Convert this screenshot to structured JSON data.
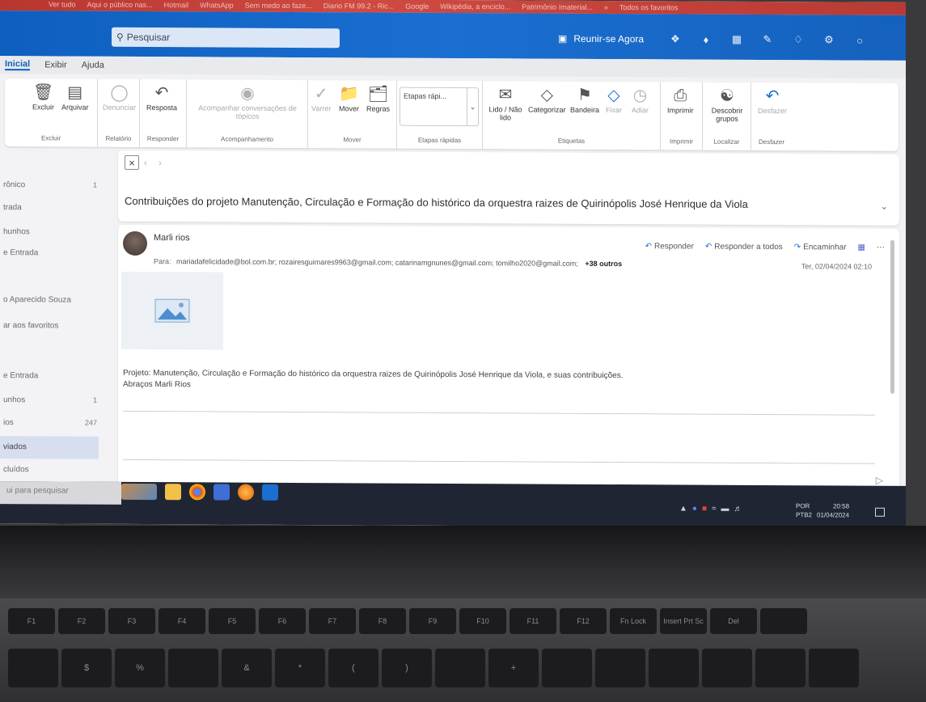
{
  "browser_bookmarks": [
    "",
    "Ver tudo",
    "Aqui o público nas...",
    "Hotmail",
    "WhatsApp",
    "Sem medo ao faze...",
    "Diario FM 99.2 - Ric...",
    "Google",
    "Wikipédia, a enciclo...",
    "Patrimônio Imaterial...",
    "»",
    "Todos os favoritos"
  ],
  "search": {
    "placeholder": "Pesquisar"
  },
  "topbar": {
    "meet_label": "Reunir-se Agora"
  },
  "menu_tabs": [
    "Inicial",
    "Exibir",
    "Ajuda"
  ],
  "ribbon": {
    "delete": "Excluir",
    "archive": "Arquivar",
    "group_delete": "Excluir",
    "report": "Denunciar",
    "group_report": "Relatório",
    "respond": "Resposta",
    "group_respond": "Responder",
    "follow": "Acompanhar conversações de tópicos",
    "group_follow": "Acompanhamento",
    "sweep": "Varrer",
    "move": "Mover",
    "rules": "Regras",
    "group_move": "Mover",
    "quick_steps": "Etapas rápi...",
    "group_quick": "Etapas rápidas",
    "read_unread": "Lido / Não lido",
    "categorize": "Categorizar",
    "flag": "Bandeira",
    "pin": "Fixar",
    "snooze": "Adiar",
    "group_tags": "Etiquetas",
    "print": "Imprimir",
    "group_print": "Imprimir",
    "discover_groups": "Descobrir grupos",
    "group_find": "Localizar",
    "undo": "Desfazer",
    "group_undo": "Desfazer"
  },
  "nav": {
    "items": [
      {
        "label": "rônico",
        "count": "1"
      },
      {
        "label": "trada",
        "count": ""
      },
      {
        "label": "hunhos",
        "count": ""
      },
      {
        "label": "e Entrada",
        "count": ""
      },
      {
        "label": "o Aparecido Souza",
        "count": ""
      },
      {
        "label": "ar aos favoritos",
        "count": ""
      },
      {
        "label": "e Entrada",
        "count": ""
      },
      {
        "label": "unhos",
        "count": "1"
      },
      {
        "label": "ios",
        "count": "247"
      },
      {
        "label": "viados",
        "count": ""
      },
      {
        "label": "cluídos",
        "count": ""
      }
    ]
  },
  "message": {
    "subject": "Contribuições do projeto Manutenção, Circulação e Formação do histórico da  orquestra raizes de Quirinópolis José Henrique da Viola",
    "sender": "Marli rios",
    "to_label": "Para:",
    "recipients": "mariadafelicidade@bol.com.br;  rozairesguimares9963@gmail.com;  catarinamgnunes@gmail.com;  tomilho2020@gmail.com;",
    "others": "+38 outros",
    "reply": "Responder",
    "reply_all": "Responder a todos",
    "forward": "Encaminhar",
    "date": "Ter, 02/04/2024 02:10",
    "body_line1": "Projeto: Manutenção, Circulação e Formação do histórico da  orquestra raizes de Quirinópolis José Henrique da Viola, e suas contribuições.",
    "body_line2": "Abraços Marli Rios"
  },
  "taskbar": {
    "search_hint": "ui para pesquisar",
    "lang_top": "POR",
    "lang_bottom": "PTB2",
    "time": "20:58",
    "date": "01/04/2024"
  },
  "keyboard": {
    "fkeys": [
      "F1",
      "F2",
      "F3",
      "F4",
      "F5",
      "F6",
      "F7",
      "F8",
      "F9",
      "F10",
      "F11",
      "F12",
      "Fn Lock",
      "Insert Prt Sc",
      "Del",
      ""
    ],
    "numkeys": [
      "",
      "$",
      "%",
      "",
      "&",
      "*",
      "(",
      ")",
      "",
      "+",
      "",
      "",
      "",
      "",
      "",
      ""
    ]
  },
  "colors": {
    "accent": "#1a6fd1",
    "topbar": "#1561bd",
    "selected_nav": "#d7def0"
  }
}
